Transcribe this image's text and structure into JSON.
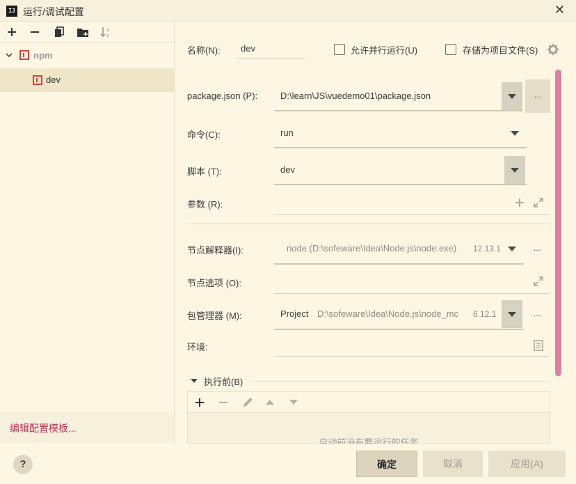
{
  "window": {
    "title": "运行/调试配置",
    "logo_text": "IJ"
  },
  "tree": {
    "group_label": "npm",
    "item_label": "dev"
  },
  "left": {
    "template_link": "编辑配置模板..."
  },
  "form": {
    "name_label": "名称(N):",
    "name_value": "dev",
    "parallel_label": "允许并行运行(U)",
    "store_label": "存储为项目文件(S)",
    "package_json_label": "package.json (P):",
    "package_json_value": "D:\\learn\\JS\\vuedemo01\\package.json",
    "command_label": "命令(C):",
    "command_value": "run",
    "script_label": "脚本 (T):",
    "script_value": "dev",
    "args_label": "参数 (R):",
    "node_interp_label": "节点解释器(I):",
    "node_interp_value": "node (D:\\sofeware\\Idea\\Node.js\\node.exe)",
    "node_interp_version": "12.13.1",
    "node_options_label": "节点选项 (O):",
    "pkg_manager_label": "包管理器 (M):",
    "pkg_manager_value": "Project",
    "pkg_manager_path": "D:\\sofeware\\Idea\\Node.js\\node_mc",
    "pkg_manager_version": "6.12.1",
    "env_label": "环境:",
    "ellipsis": "...",
    "before_launch_label": "执行前(B)",
    "before_launch_empty": "启动前没有要运行的任务"
  },
  "buttons": {
    "ok": "确定",
    "cancel": "取消",
    "apply": "应用(A)",
    "help": "?"
  }
}
